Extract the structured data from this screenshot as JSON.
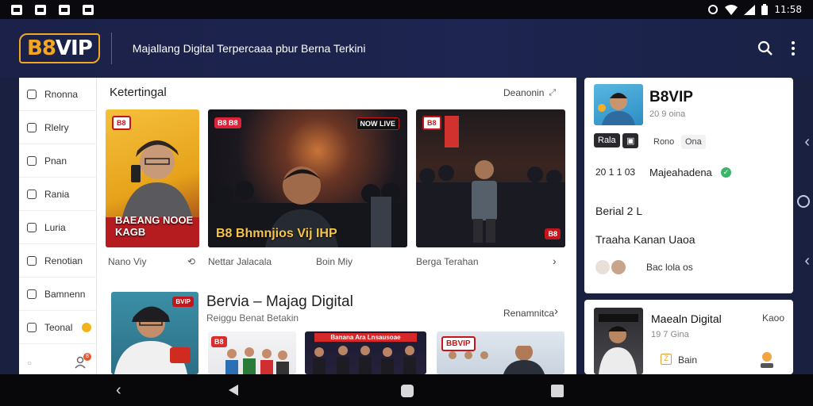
{
  "status_bar": {
    "time": "11:58"
  },
  "app": {
    "logo_main": "B8",
    "logo_accent": "VIP",
    "tagline": "Majallang Digital Terpercaaa pbur Berna Terkini"
  },
  "sidebar": {
    "items": [
      {
        "label": "Rnonna"
      },
      {
        "label": "Rlelry"
      },
      {
        "label": "Pnan"
      },
      {
        "label": "Rania"
      },
      {
        "label": "Luria"
      },
      {
        "label": "Renotian"
      },
      {
        "label": "Bamnenn"
      },
      {
        "label": "Teonal"
      }
    ],
    "notification_count": "8"
  },
  "section1": {
    "title": "Ketertingal",
    "link": "Deanonin",
    "cards": [
      {
        "badge": "B8",
        "overlay_title": "BAEANG NOOE KAGB",
        "caption": "Nano Viy",
        "caption_icon": "⟲"
      },
      {
        "badge": "B8 B8",
        "badge2": "NOW LIVE",
        "overlay_title": "B8 Bhmnjios  Vij IHP",
        "caption": "Nettar Jalacala",
        "caption2": "Boin Miy"
      },
      {
        "badge": "B8",
        "caption": "Berga Terahan"
      }
    ]
  },
  "section2": {
    "title": "Bervia – Majag Digital",
    "subtitle": "Reiggu Benat Betakin",
    "link": "Renamnitca",
    "badge": "BVIP",
    "card2_banner": "Banana Ara Lnsausoae",
    "card3_badge": "BBVIP"
  },
  "profile": {
    "name": "B8VIP",
    "followers": "20 9 oina",
    "chip1": "Rala",
    "chip2": "Rono",
    "chip3": "Ona",
    "stats_num": "20 1 1 03",
    "stats_label": "Majeahadena",
    "section_label": "Berial 2 L",
    "section_sub": "Traaha Kanan Uaoa",
    "footer_label": "Bac lola os"
  },
  "card_panel": {
    "title": "Maealn Digital",
    "meta": "19 7 Gina",
    "tag": "Kaoo",
    "action": "Bain"
  }
}
